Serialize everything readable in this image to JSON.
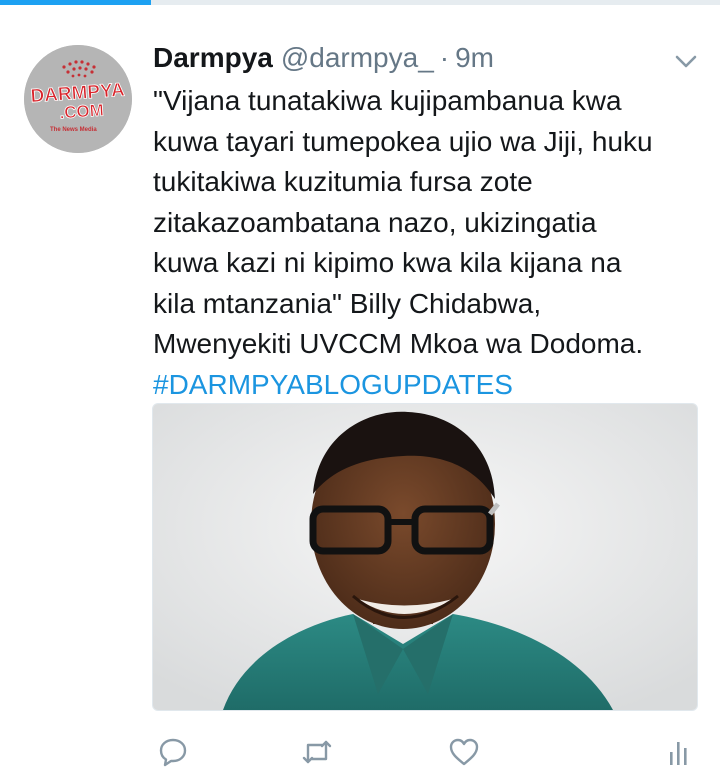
{
  "progress": {
    "value_fraction": 0.21
  },
  "tweet": {
    "author_name": "Darmpya",
    "handle": "@darmpya_",
    "separator": "·",
    "time": "9m",
    "lines": [
      "\"Vijana tunatakiwa kujipambanua kwa",
      "kuwa tayari tumepokea ujio wa Jiji, huku",
      "tukitakiwa kuzitumia fursa zote",
      "zitakazoambatana nazo, ukizingatia",
      "kuwa kazi ni kipimo kwa kila kijana na",
      "kila mtanzania\" Billy Chidabwa,",
      "Mwenyekiti UVCCM Mkoa wa Dodoma."
    ],
    "hashtag": "#DARMPYABLOGUPDATES",
    "avatar": {
      "logo_line1": "DARMPYA",
      "logo_line2": ".COM",
      "logo_tagline": "The News Media"
    }
  },
  "icons": {
    "caret": "chevron-down-icon",
    "reply": "reply-icon",
    "retweet": "retweet-icon",
    "like": "heart-icon",
    "analytics": "analytics-icon"
  },
  "colors": {
    "accent": "#1da1f2",
    "hashtag": "#1b95e0",
    "muted": "#657786",
    "logo_red": "#d8232a"
  }
}
